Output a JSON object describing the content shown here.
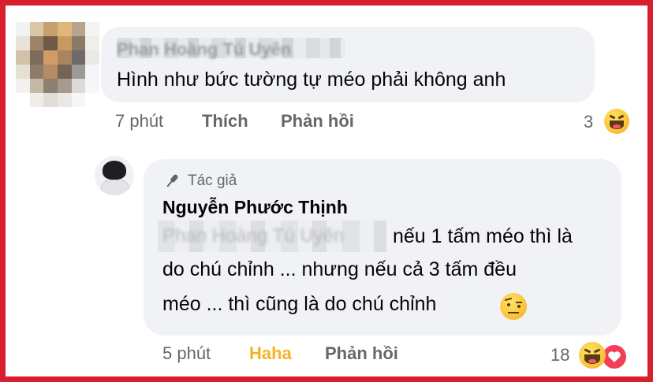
{
  "comment": {
    "author": "Phan Hoàng Tú Uyên",
    "text": "Hình như bức tường tự méo phải không anh",
    "time": "7 phút",
    "like_label": "Thích",
    "reply_label": "Phản hồi",
    "reaction_count": "3",
    "reaction_icons": [
      "haha-icon"
    ]
  },
  "reply": {
    "author_badge": "Tác giả",
    "author": "Nguyễn Phước Thịnh",
    "mention": "Phan Hoàng Tú Uyên",
    "text_line1": "nếu 1 tấm méo thì là",
    "text_line2": "do chú chỉnh ... nhưng nếu cả 3 tấm đều",
    "text_line3": "méo ... thì cũng là do chú chỉnh",
    "inline_emoji": "raised-eyebrow-icon",
    "time": "5 phút",
    "reaction_label": "Haha",
    "reply_label": "Phản hồi",
    "reaction_count": "18",
    "reaction_icons": [
      "haha-icon",
      "love-icon"
    ]
  },
  "colors": {
    "frame": "#d81f2d",
    "bubble": "#f0f2f5",
    "meta_text": "#65676b",
    "haha_active": "#f7b125",
    "love": "#f33e58"
  }
}
